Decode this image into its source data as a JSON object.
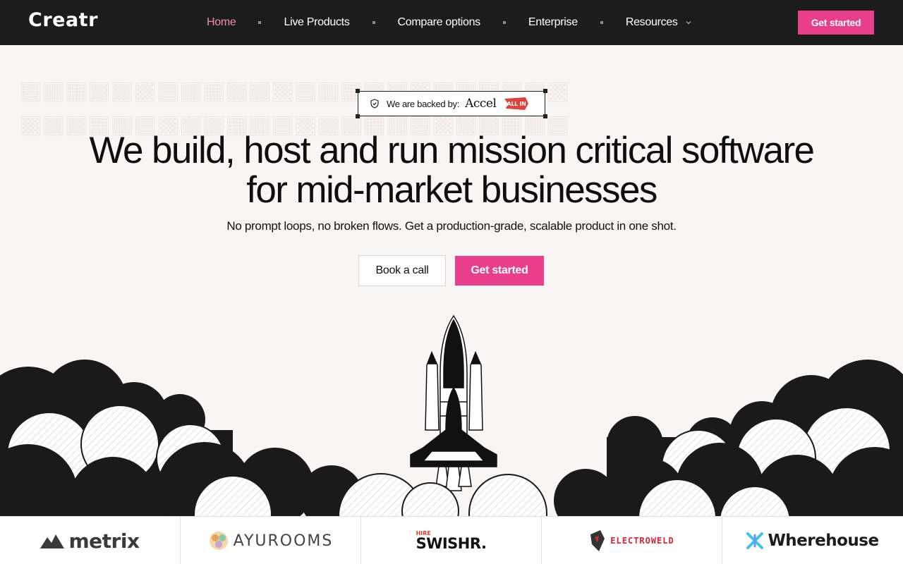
{
  "nav": {
    "logo": "Creatr",
    "items": [
      {
        "label": "Home",
        "active": true
      },
      {
        "label": "Live Products"
      },
      {
        "label": "Compare options"
      },
      {
        "label": "Enterprise"
      },
      {
        "label": "Resources"
      }
    ],
    "cta": "Get started"
  },
  "hero": {
    "badge_text": "We are backed by:",
    "badge_brand": "Accel",
    "badge_brand2": "ALL IN",
    "headline_line1": "We build, host and run mission critical software",
    "headline_line2": "for mid-market businesses",
    "subheadline": "No prompt loops, no broken flows. Get a production-grade, scalable product in one shot.",
    "btn_secondary": "Book a call",
    "btn_primary": "Get started"
  },
  "logos": {
    "metrix": "metrix",
    "ayurooms": "AYUROOMS",
    "swishr_tag": "HIRE",
    "swishr": "SWISHR.",
    "electroweld": "ELECTROWELD",
    "wherehouse": "Wherehouse"
  },
  "colors": {
    "nav_bg": "#1c1c1c",
    "accent": "#e83e8c",
    "active_nav": "#f08cb4",
    "page_bg": "#f8f5f4"
  }
}
